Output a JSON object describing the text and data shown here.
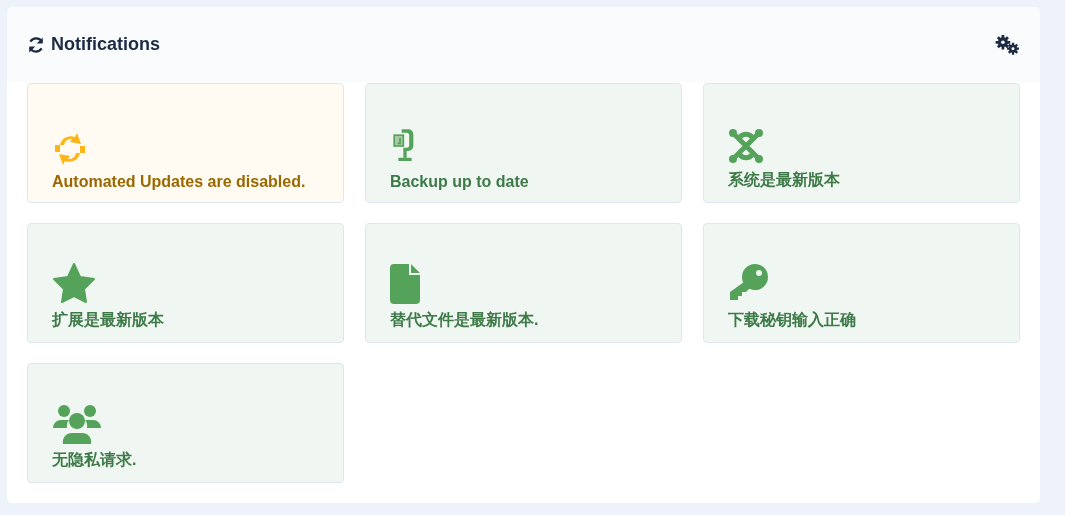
{
  "panel": {
    "title": "Notifications"
  },
  "tiles": [
    {
      "kind": "warning",
      "text": "Automated Updates are disabled."
    },
    {
      "kind": "success",
      "text": "Backup up to date"
    },
    {
      "kind": "success",
      "text": "系统是最新版本"
    },
    {
      "kind": "success",
      "text": "扩展是最新版本"
    },
    {
      "kind": "success",
      "text": "替代文件是最新版本."
    },
    {
      "kind": "success",
      "text": "下载秘钥输入正确"
    },
    {
      "kind": "success",
      "text": "无隐私请求."
    }
  ]
}
